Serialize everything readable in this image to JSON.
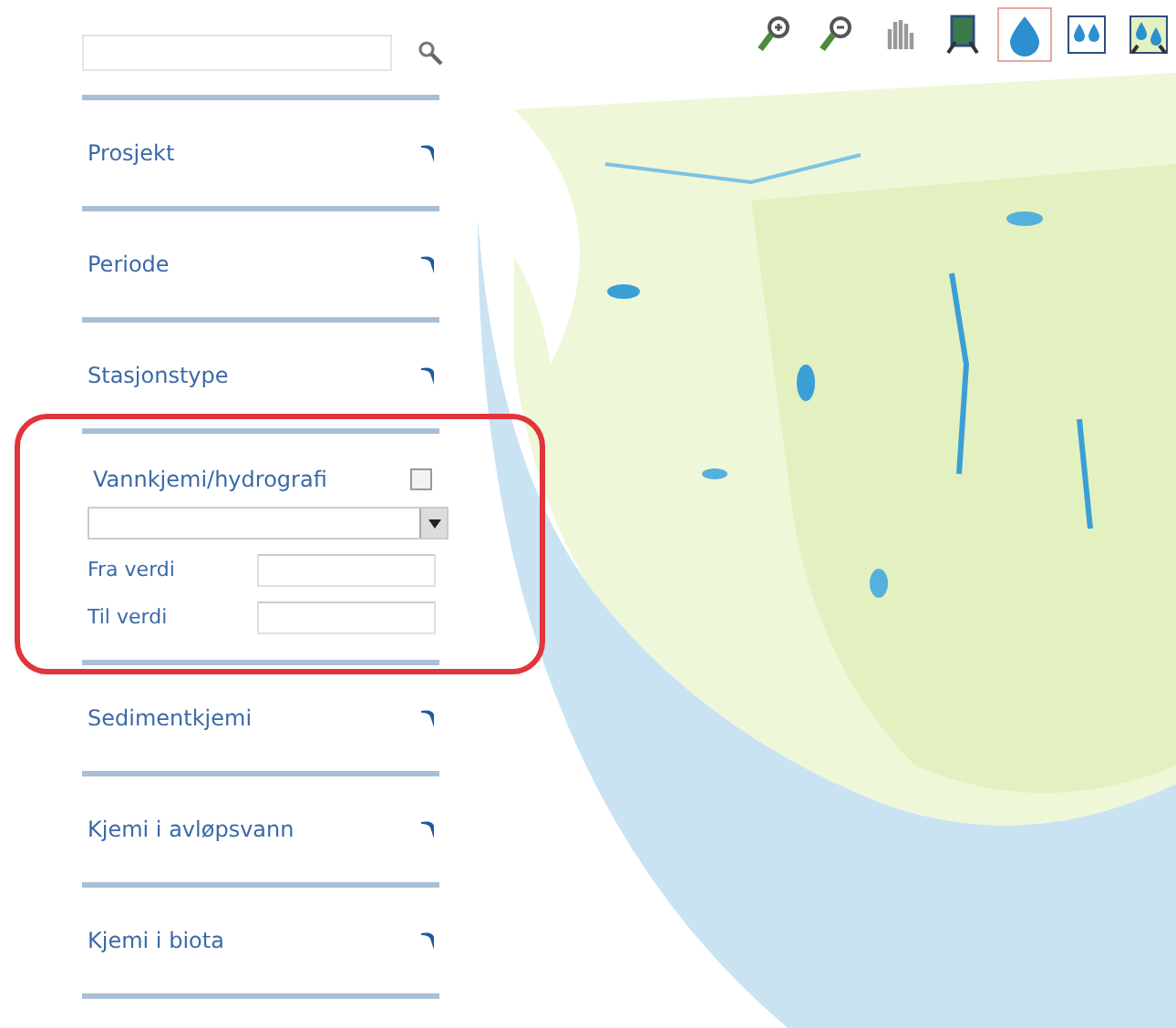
{
  "tools": [
    {
      "kind": "zoom-in",
      "selected": false
    },
    {
      "kind": "zoom-out",
      "selected": false
    },
    {
      "kind": "pan",
      "selected": false
    },
    {
      "kind": "map",
      "selected": false
    },
    {
      "kind": "drop",
      "selected": true
    },
    {
      "kind": "drops",
      "selected": false
    },
    {
      "kind": "drops2",
      "selected": false
    }
  ],
  "sections": [
    {
      "title": "Prosjekt",
      "expanded": false
    },
    {
      "title": "Periode",
      "expanded": false
    },
    {
      "title": "Stasjonstype",
      "expanded": false
    },
    {
      "title": "Vannkjemi/hydrografi",
      "expanded": true,
      "checked": false,
      "highlighted": true,
      "fields": [
        {
          "label": "Fra verdi"
        },
        {
          "label": "Til verdi"
        }
      ]
    },
    {
      "title": "Sedimentkjemi",
      "expanded": false
    },
    {
      "title": "Kjemi i avløpsvann",
      "expanded": false
    },
    {
      "title": "Kjemi i biota",
      "expanded": false
    }
  ]
}
